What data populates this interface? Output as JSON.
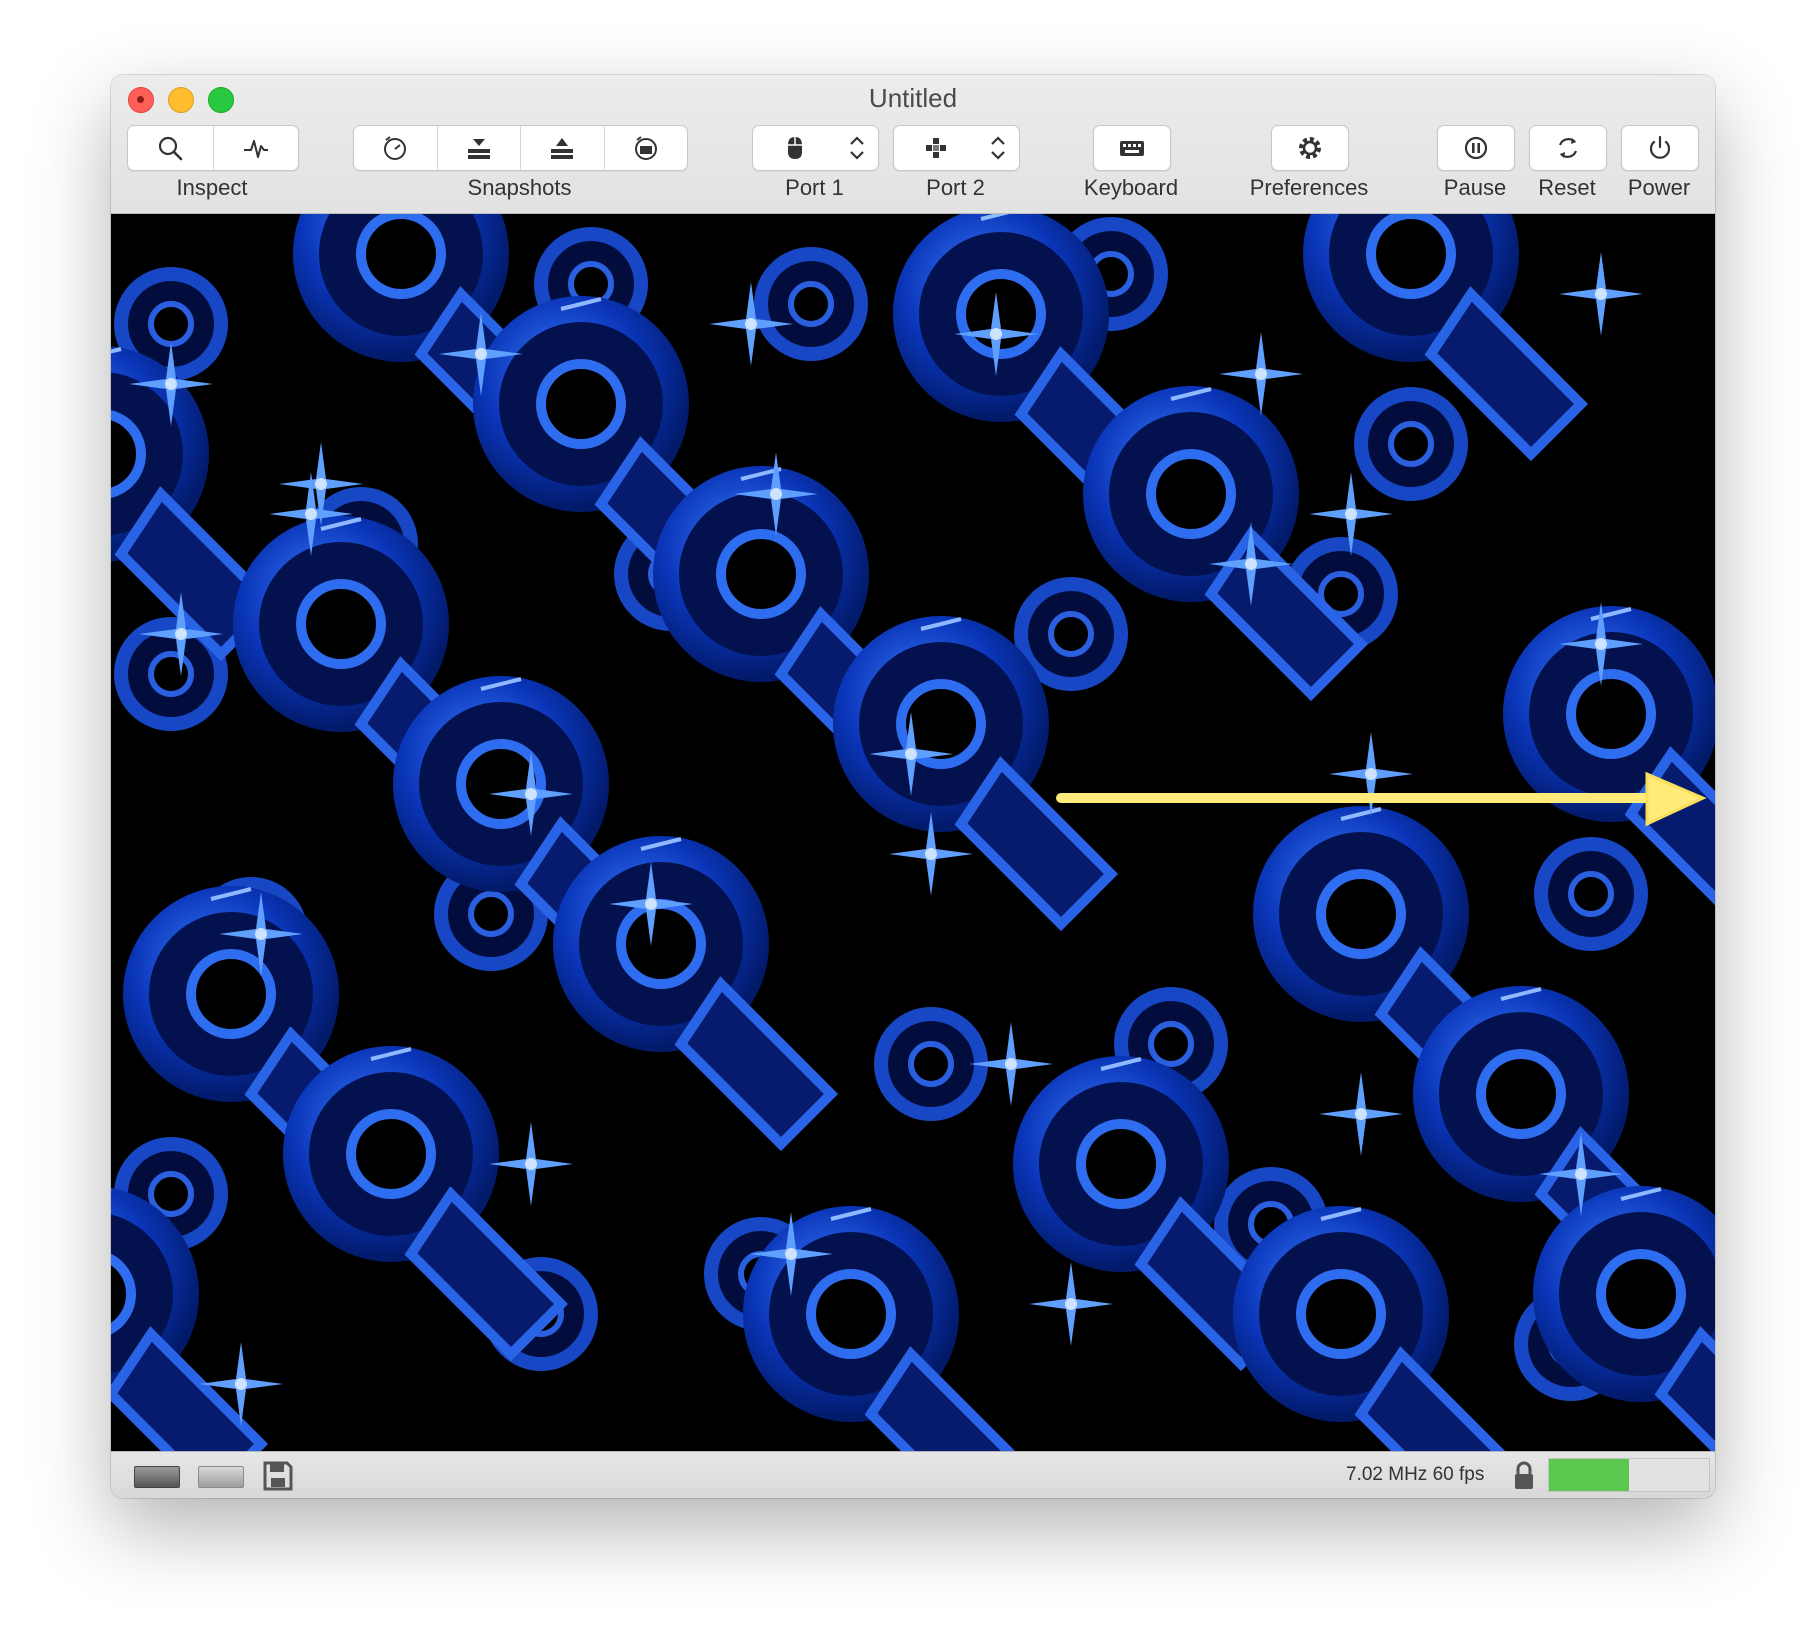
{
  "window": {
    "title": "Untitled"
  },
  "toolbar": {
    "inspect_label": "Inspect",
    "snapshots_label": "Snapshots",
    "port1_label": "Port 1",
    "port2_label": "Port 2",
    "keyboard_label": "Keyboard",
    "preferences_label": "Preferences",
    "pause_label": "Pause",
    "reset_label": "Reset",
    "power_label": "Power"
  },
  "icons": {
    "inspect": [
      "magnifier-icon",
      "waveform-icon"
    ],
    "snapshots": [
      "snapshot-timer-icon",
      "snapshot-take-icon",
      "snapshot-restore-icon",
      "snapshot-browse-icon"
    ],
    "port1": "mouse-icon",
    "port2": "joystick-icon",
    "keyboard": "keyboard-icon",
    "preferences": "gear-icon",
    "pause": "pause-icon",
    "reset": "reset-icon",
    "power": "power-icon"
  },
  "status": {
    "speed_text": "7.02 MHz 60 fps",
    "warp_load_fraction": 0.5,
    "gauge_color": "#5cc84f"
  }
}
